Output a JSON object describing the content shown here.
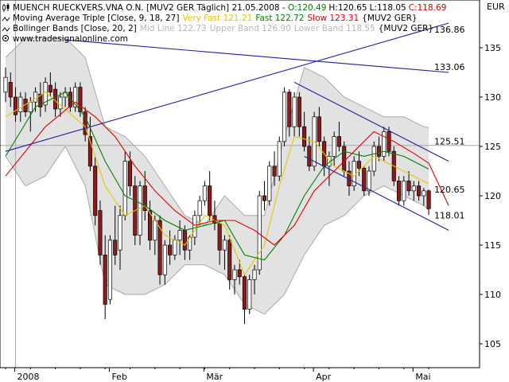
{
  "header": {
    "line1": {
      "icon": "candlestick-icon",
      "title": "MUENCH RUECKVERS.VNA O.N. [MUV2 GER  Täglich] 21.05.2008",
      "ohlc_prefix": " - ",
      "open": "O:120.49",
      "high": "H:120.65",
      "low": "L:118.05",
      "close": "C:118.69"
    },
    "line2": {
      "icon": "line-indicator-icon",
      "name": "Moving Average Triple [Close, 9, 18, 27]",
      "very_fast": "Very Fast 121.21",
      "fast": "Fast 122.72",
      "slow": "Slow 123.31",
      "symbol": "{MUV2 GER}"
    },
    "line3": {
      "icon": "line-indicator-icon",
      "name": "Bollinger Bands [Close, 20, 2]",
      "mid": "Mid Line 122.73",
      "upper": "Upper Band 126.90",
      "lower": "Lower Band 118.55",
      "symbol": "{MUV2 GER}"
    },
    "line4": {
      "icon": "copyright-icon",
      "text": "www.tradesignalonline.com"
    }
  },
  "currency": "EUR",
  "colors": {
    "up": "#ffffff",
    "down": "#8b1a1a",
    "very_fast": "#e8c800",
    "fast": "#008000",
    "slow": "#e00000",
    "band_fill": "#d8d8d8",
    "band_line": "#a9a9a9",
    "trend": "#1f1f9f",
    "grid": "#a8a8a8"
  },
  "chart_data": {
    "type": "candlestick",
    "y_axis": {
      "min": 103,
      "max": 139,
      "ticks": [
        105,
        110,
        115,
        120,
        125,
        130,
        135
      ],
      "side": "right"
    },
    "x_axis": {
      "labels": [
        "2008",
        "Feb",
        "Mär",
        "Apr",
        "Mai"
      ],
      "label_index": [
        2,
        21,
        40,
        62,
        82
      ]
    },
    "candles": [
      {
        "o": 130.5,
        "h": 133,
        "l": 129.5,
        "c": 132
      },
      {
        "o": 131.5,
        "h": 132.5,
        "l": 129,
        "c": 130
      },
      {
        "o": 130,
        "h": 131,
        "l": 127.5,
        "c": 128.2
      },
      {
        "o": 128.5,
        "h": 130.5,
        "l": 127.5,
        "c": 130
      },
      {
        "o": 129.8,
        "h": 130.5,
        "l": 128,
        "c": 128.5
      },
      {
        "o": 128.5,
        "h": 130,
        "l": 126.5,
        "c": 129.5
      },
      {
        "o": 129.5,
        "h": 131,
        "l": 128.5,
        "c": 130.5
      },
      {
        "o": 130.3,
        "h": 131.5,
        "l": 128,
        "c": 129
      },
      {
        "o": 129.2,
        "h": 132,
        "l": 128.5,
        "c": 131.5
      },
      {
        "o": 131.2,
        "h": 132.5,
        "l": 130,
        "c": 130.5
      },
      {
        "o": 130.8,
        "h": 131.5,
        "l": 128,
        "c": 128.8
      },
      {
        "o": 128.8,
        "h": 130.5,
        "l": 128,
        "c": 130
      },
      {
        "o": 130,
        "h": 131,
        "l": 129,
        "c": 130.5
      },
      {
        "o": 130.5,
        "h": 131,
        "l": 128.5,
        "c": 129
      },
      {
        "o": 129,
        "h": 131.5,
        "l": 128.5,
        "c": 131
      },
      {
        "o": 131,
        "h": 131.5,
        "l": 128,
        "c": 128.5
      },
      {
        "o": 128.5,
        "h": 129,
        "l": 125.5,
        "c": 126.2
      },
      {
        "o": 126,
        "h": 128,
        "l": 122.5,
        "c": 123
      },
      {
        "o": 123,
        "h": 124,
        "l": 117,
        "c": 118
      },
      {
        "o": 118.5,
        "h": 119.5,
        "l": 113,
        "c": 114
      },
      {
        "o": 114,
        "h": 116,
        "l": 107.5,
        "c": 109
      },
      {
        "o": 109.5,
        "h": 116,
        "l": 109,
        "c": 115.5
      },
      {
        "o": 115.5,
        "h": 119,
        "l": 113,
        "c": 114
      },
      {
        "o": 114.5,
        "h": 119,
        "l": 112.5,
        "c": 118
      },
      {
        "o": 118,
        "h": 124.5,
        "l": 117.5,
        "c": 123.5
      },
      {
        "o": 123.5,
        "h": 124.5,
        "l": 120,
        "c": 121
      },
      {
        "o": 121,
        "h": 122,
        "l": 115,
        "c": 116
      },
      {
        "o": 116,
        "h": 121.5,
        "l": 115,
        "c": 121
      },
      {
        "o": 121,
        "h": 122.5,
        "l": 117.5,
        "c": 118.5
      },
      {
        "o": 118.5,
        "h": 119.5,
        "l": 114.5,
        "c": 115.5
      },
      {
        "o": 115.5,
        "h": 118,
        "l": 114,
        "c": 117.5
      },
      {
        "o": 117.5,
        "h": 118,
        "l": 111,
        "c": 112
      },
      {
        "o": 112,
        "h": 115.5,
        "l": 111,
        "c": 115
      },
      {
        "o": 115,
        "h": 116.5,
        "l": 113,
        "c": 114
      },
      {
        "o": 114,
        "h": 116,
        "l": 113.5,
        "c": 115.5
      },
      {
        "o": 115.5,
        "h": 117.5,
        "l": 114,
        "c": 116.5
      },
      {
        "o": 116.5,
        "h": 117,
        "l": 113.5,
        "c": 114.5
      },
      {
        "o": 114.5,
        "h": 116,
        "l": 113.5,
        "c": 115.8
      },
      {
        "o": 115.8,
        "h": 118.5,
        "l": 115,
        "c": 118
      },
      {
        "o": 118,
        "h": 120,
        "l": 117,
        "c": 119.5
      },
      {
        "o": 119.5,
        "h": 121.5,
        "l": 119,
        "c": 121
      },
      {
        "o": 121,
        "h": 122.5,
        "l": 117.5,
        "c": 118
      },
      {
        "o": 118,
        "h": 119.5,
        "l": 116.5,
        "c": 117.2
      },
      {
        "o": 117.2,
        "h": 117.5,
        "l": 113,
        "c": 114.5
      },
      {
        "o": 114.5,
        "h": 116,
        "l": 112.5,
        "c": 115.5
      },
      {
        "o": 115.5,
        "h": 116,
        "l": 110.5,
        "c": 111.5
      },
      {
        "o": 111.5,
        "h": 113,
        "l": 110,
        "c": 112.5
      },
      {
        "o": 112.5,
        "h": 113.5,
        "l": 111,
        "c": 111.8
      },
      {
        "o": 111.8,
        "h": 112,
        "l": 107,
        "c": 108.5
      },
      {
        "o": 108.5,
        "h": 112,
        "l": 108,
        "c": 111.5
      },
      {
        "o": 111.5,
        "h": 113,
        "l": 110,
        "c": 112.5
      },
      {
        "o": 112.5,
        "h": 120.5,
        "l": 112,
        "c": 120
      },
      {
        "o": 120,
        "h": 121.5,
        "l": 118.5,
        "c": 119.5
      },
      {
        "o": 119.5,
        "h": 123.5,
        "l": 119,
        "c": 123
      },
      {
        "o": 123,
        "h": 124.5,
        "l": 121,
        "c": 122
      },
      {
        "o": 122,
        "h": 126,
        "l": 121.5,
        "c": 125.5
      },
      {
        "o": 125.5,
        "h": 131,
        "l": 125,
        "c": 130.5
      },
      {
        "o": 130.5,
        "h": 130.8,
        "l": 126,
        "c": 127
      },
      {
        "o": 127,
        "h": 130.5,
        "l": 126,
        "c": 130
      },
      {
        "o": 130,
        "h": 130.5,
        "l": 126,
        "c": 127
      },
      {
        "o": 127,
        "h": 128.5,
        "l": 124.5,
        "c": 125
      },
      {
        "o": 125,
        "h": 126,
        "l": 122.5,
        "c": 123
      },
      {
        "o": 123,
        "h": 128.5,
        "l": 122.5,
        "c": 128
      },
      {
        "o": 128,
        "h": 129,
        "l": 125,
        "c": 125.5
      },
      {
        "o": 125.5,
        "h": 126,
        "l": 122,
        "c": 123
      },
      {
        "o": 123,
        "h": 124.5,
        "l": 121,
        "c": 124
      },
      {
        "o": 124,
        "h": 126.5,
        "l": 123,
        "c": 126
      },
      {
        "o": 126,
        "h": 127.5,
        "l": 124.5,
        "c": 125
      },
      {
        "o": 125,
        "h": 125.5,
        "l": 122,
        "c": 122.5
      },
      {
        "o": 122.5,
        "h": 123.5,
        "l": 120,
        "c": 121
      },
      {
        "o": 121,
        "h": 124,
        "l": 120.5,
        "c": 123.5
      },
      {
        "o": 123.5,
        "h": 124.5,
        "l": 122,
        "c": 122.8
      },
      {
        "o": 122.8,
        "h": 123,
        "l": 120,
        "c": 120.5
      },
      {
        "o": 120.5,
        "h": 123,
        "l": 120,
        "c": 122.5
      },
      {
        "o": 122.5,
        "h": 125.5,
        "l": 122,
        "c": 125
      },
      {
        "o": 125,
        "h": 126,
        "l": 123.5,
        "c": 124
      },
      {
        "o": 124,
        "h": 127,
        "l": 123.5,
        "c": 126.5
      },
      {
        "o": 126.5,
        "h": 127,
        "l": 124,
        "c": 124.5
      },
      {
        "o": 124.5,
        "h": 125,
        "l": 121,
        "c": 121.5
      },
      {
        "o": 121.5,
        "h": 122,
        "l": 119,
        "c": 119.5
      },
      {
        "o": 119.5,
        "h": 122,
        "l": 119,
        "c": 121.5
      },
      {
        "o": 121.5,
        "h": 122.5,
        "l": 120,
        "c": 120.5
      },
      {
        "o": 120.5,
        "h": 121.5,
        "l": 119.5,
        "c": 121
      },
      {
        "o": 121,
        "h": 121.5,
        "l": 119.5,
        "c": 120
      },
      {
        "o": 120,
        "h": 120.8,
        "l": 119,
        "c": 120.5
      },
      {
        "o": 120.5,
        "h": 120.65,
        "l": 118.05,
        "c": 118.69
      }
    ],
    "series": [
      {
        "name": "Very Fast",
        "color": "#e8c800",
        "x": [
          0,
          8,
          16,
          20,
          24,
          28,
          32,
          36,
          40,
          44,
          48,
          52,
          55,
          58,
          62,
          66,
          70,
          74,
          78,
          85
        ],
        "y": [
          128,
          130.5,
          127,
          121,
          118,
          119,
          116,
          115,
          118,
          117,
          112,
          115,
          121,
          126,
          125.5,
          123,
          122,
          124,
          123,
          121.2
        ]
      },
      {
        "name": "Fast",
        "color": "#008000",
        "x": [
          0,
          6,
          12,
          16,
          20,
          24,
          28,
          32,
          36,
          40,
          44,
          48,
          52,
          56,
          60,
          64,
          68,
          72,
          76,
          80,
          85
        ],
        "y": [
          124,
          129,
          130.5,
          128,
          123.5,
          120,
          119,
          117.5,
          116.5,
          117,
          117.5,
          114,
          113.5,
          116,
          120,
          123,
          124.5,
          124,
          124.5,
          124,
          122.7
        ]
      },
      {
        "name": "Slow",
        "color": "#e00000",
        "x": [
          0,
          8,
          14,
          18,
          22,
          26,
          30,
          34,
          38,
          42,
          46,
          50,
          54,
          58,
          62,
          66,
          70,
          74,
          78,
          82,
          85,
          89
        ],
        "y": [
          122,
          127,
          129.5,
          128,
          126,
          123,
          120.5,
          118.5,
          117,
          117.5,
          117.5,
          116.5,
          115,
          117,
          120.5,
          122.5,
          124.5,
          126.5,
          125.5,
          124.3,
          123.3,
          119
        ]
      }
    ],
    "bollinger": {
      "x": [
        0,
        4,
        8,
        12,
        16,
        20,
        24,
        28,
        32,
        36,
        40,
        44,
        48,
        52,
        56,
        60,
        64,
        68,
        72,
        76,
        80,
        84,
        85
      ],
      "upper": [
        134,
        136,
        136,
        136,
        134,
        127,
        126,
        124,
        121,
        118,
        117,
        120,
        118,
        118,
        126,
        133,
        132,
        130,
        129,
        128,
        128,
        127,
        126.9
      ],
      "lower": [
        124,
        121,
        122,
        125,
        121,
        111,
        110,
        110,
        111,
        113,
        113,
        112,
        109,
        108,
        110,
        114,
        117,
        118,
        120,
        121,
        120,
        119,
        118.55
      ]
    },
    "trend_lines": [
      {
        "x": [
          0,
          89
        ],
        "y": [
          124.5,
          137.5
        ],
        "label": "136.86"
      },
      {
        "x": [
          12,
          89
        ],
        "y": [
          135.8,
          132.5
        ],
        "label": "133.06"
      },
      {
        "x": [
          58,
          89
        ],
        "y": [
          131.5,
          123.5
        ],
        "label": "125.51"
      },
      {
        "x": [
          60,
          89
        ],
        "y": [
          124,
          116.5
        ],
        "label": "120.65"
      }
    ],
    "price_labels": [
      {
        "text": "136.86",
        "color": "#1f1f9f",
        "y": 136.86
      },
      {
        "text": "133.06",
        "color": "#1f1f9f",
        "y": 133.06
      },
      {
        "text": "125.51",
        "color": "#1f1f9f",
        "y": 125.51
      },
      {
        "text": "120.65",
        "color": "#cc0000",
        "y": 120.65
      },
      {
        "text": "118.01",
        "color": "#1f1f9f",
        "y": 118.01
      }
    ],
    "hline": 125.1,
    "vline_index": 2
  }
}
